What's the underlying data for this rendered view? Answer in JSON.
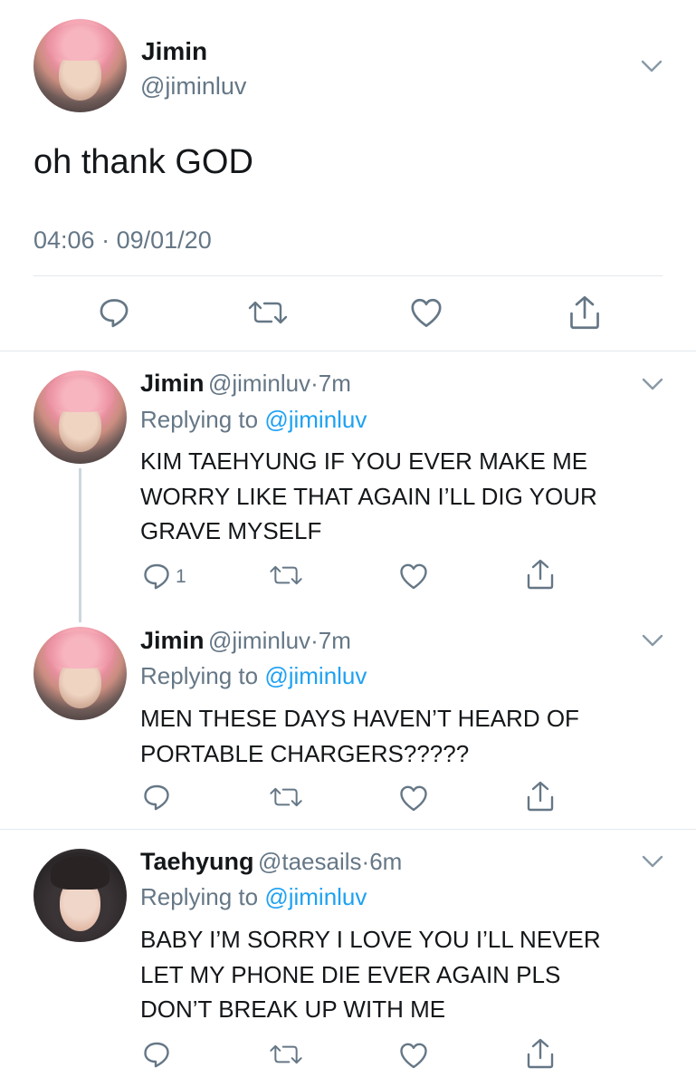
{
  "main_tweet": {
    "name": "Jimin",
    "handle": "@jiminluv",
    "text": "oh thank GOD",
    "time": "04:06",
    "separator": "·",
    "date": "09/01/20",
    "avatar": "pink-hair-avatar"
  },
  "replies": [
    {
      "name": "Jimin",
      "handle": "@jiminluv",
      "dot": "·",
      "age": "7m",
      "replying_prefix": "Replying to",
      "replying_to": "@jiminluv",
      "lines": [
        "KIM TAEHYUNG IF YOU EVER MAKE ME",
        "WORRY LIKE THAT AGAIN I’LL DIG YOUR",
        "GRAVE MYSELF"
      ],
      "reply_count": "1",
      "avatar": "pink-hair-avatar"
    },
    {
      "name": "Jimin",
      "handle": "@jiminluv",
      "dot": "·",
      "age": "7m",
      "replying_prefix": "Replying to",
      "replying_to": "@jiminluv",
      "lines": [
        "MEN THESE DAYS HAVEN’T HEARD OF",
        "PORTABLE CHARGERS?????"
      ],
      "reply_count": "",
      "avatar": "pink-hair-avatar"
    },
    {
      "name": "Taehyung",
      "handle": "@taesails",
      "dot": "·",
      "age": "6m",
      "replying_prefix": "Replying to",
      "replying_to": "@jiminluv",
      "lines": [
        "BABY I’M SORRY I LOVE YOU I’LL NEVER",
        "LET MY PHONE DIE EVER AGAIN PLS",
        "DON’T BREAK UP WITH ME"
      ],
      "reply_count": "",
      "avatar": "dark-hair-avatar"
    }
  ],
  "icons": {
    "reply": "reply-icon",
    "retweet": "retweet-icon",
    "like": "heart-icon",
    "share": "share-icon",
    "more": "chevron-down-icon"
  },
  "colors": {
    "text": "#14171a",
    "muted": "#657786",
    "link": "#1da1f2",
    "divider": "#e1e8ed"
  }
}
